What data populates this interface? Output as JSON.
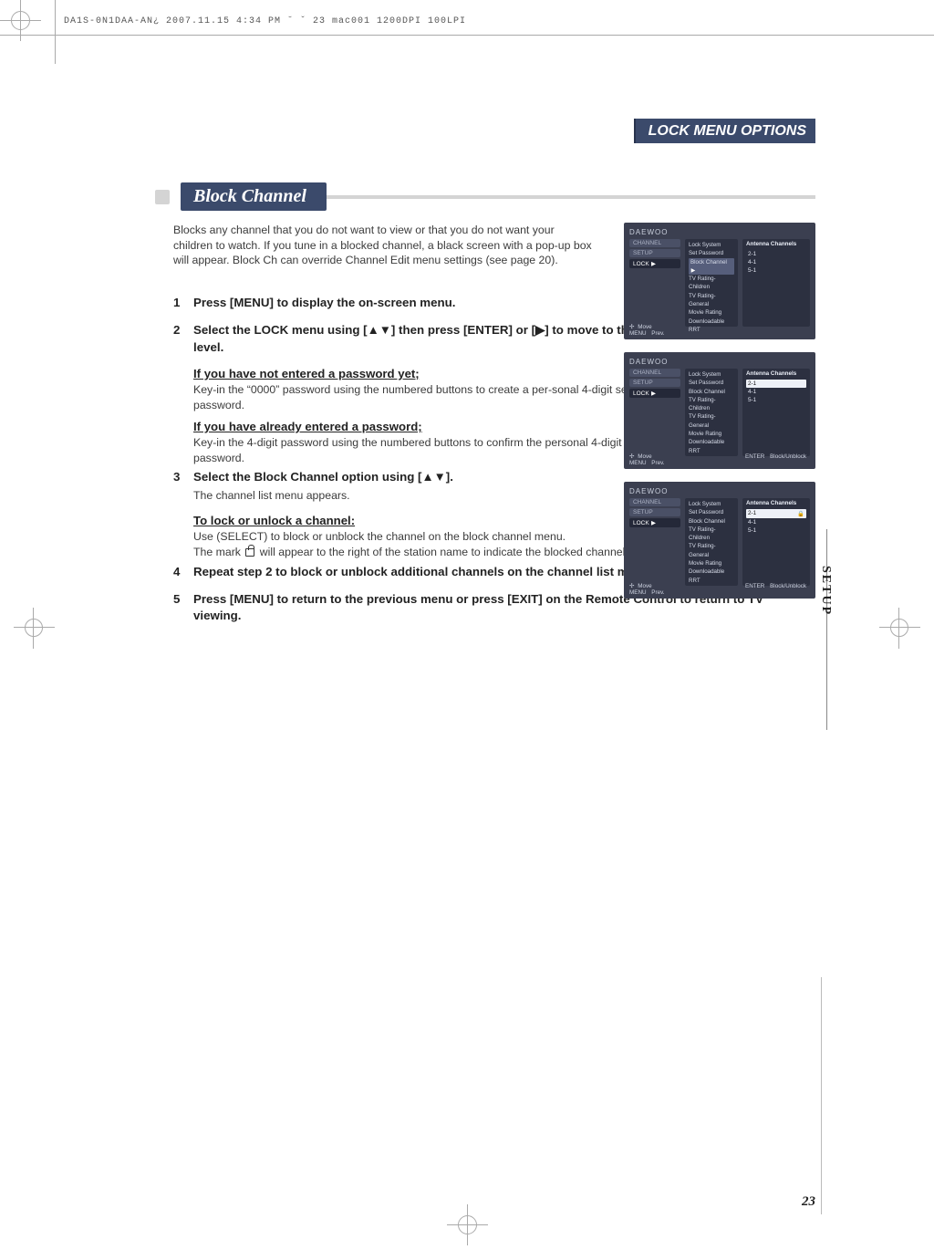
{
  "print": {
    "header": "DA1S-0N1DAA-AN¿   2007.11.15 4:34 PM   ˘   ˇ  23    mac001  1200DPI 100LPI"
  },
  "header": {
    "title": "LOCK MENU OPTIONS"
  },
  "section": {
    "title": "Block Channel"
  },
  "intro": "Blocks any channel that you do not want to view or that you do not want your children to watch. If you tune in a blocked channel, a black screen with a pop-up box will appear. Block Ch can override Channel Edit menu settings (see page 20).",
  "steps": {
    "s1": {
      "n": "1",
      "t": "Press [MENU] to display the on-screen menu."
    },
    "s2": {
      "n": "2",
      "t": "Select the LOCK menu using [▲▼] then press [ENTER] or [▶] to move to the second level."
    },
    "sub_pw_not": {
      "h": "If you have not entered a password yet;",
      "b": "Key-in the “0000” password using the numbered buttons to create a per-sonal 4-digit security password."
    },
    "sub_pw_yes": {
      "h": "If you have already entered a password;",
      "b": "Key-in the 4-digit password using the numbered buttons to confirm the personal 4-digit security password."
    },
    "s3": {
      "n": "3",
      "t": "Select the Block Channel option using [▲▼].",
      "sub": "The channel list menu appears."
    },
    "sub_lock": {
      "h": "To lock or unlock a channel:",
      "b1": "Use (SELECT) to block or unblock the channel on the block channel menu.",
      "b2a": "The mark ",
      "b2b": " will appear to the right of the station name to indicate the blocked channel."
    },
    "s4": {
      "n": "4",
      "t": "Repeat step 2 to block or unblock additional channels on the channel list menu."
    },
    "s5": {
      "n": "5",
      "t": "Press [MENU] to return to the previous menu or press [EXIT] on the Remote Control to return to TV viewing."
    }
  },
  "screens": {
    "brand": "DAEWOO",
    "tabs": {
      "channel": "CHANNEL",
      "setup": "SETUP",
      "lock": "LOCK"
    },
    "arrow": "▶",
    "menu": {
      "i1": "Lock System",
      "i2": "Set Password",
      "i3": "Block Channel",
      "i4": "TV Rating-Children",
      "i5": "TV Rating-General",
      "i6": "Movie Rating",
      "i7": "Downloadable RRT"
    },
    "right": {
      "title": "Antenna Channels",
      "r1": "2-1",
      "r2": "4-1",
      "r3": "5-1",
      "lock": "🔒"
    },
    "foot": {
      "move": "Move",
      "prev": "Prev.",
      "enter": "ENTER",
      "block": "Block/Unblock",
      "menuicon": "MENU",
      "arrows": "✢"
    }
  },
  "sidebar": {
    "label": "SETUP"
  },
  "page": {
    "num": "23"
  }
}
